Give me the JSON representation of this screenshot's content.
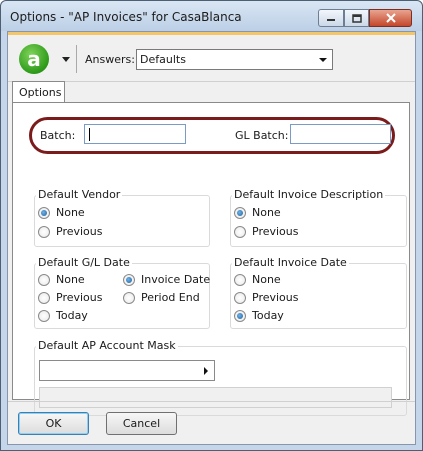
{
  "window": {
    "title": "Options - \"AP Invoices\" for CasaBlanca"
  },
  "title_buttons": {
    "minimize_icon": "minimize-icon",
    "maximize_icon": "maximize-icon",
    "close_icon": "close-icon"
  },
  "toolbar": {
    "logo_letter": "a",
    "answers_label": "Answers:",
    "answers_value": "Defaults"
  },
  "tabs": [
    {
      "label": "Options",
      "selected": true
    }
  ],
  "batch": {
    "batch_label": "Batch:",
    "batch_value": "",
    "gl_batch_label": "GL Batch:",
    "gl_batch_value": ""
  },
  "default_vendor": {
    "title": "Default Vendor",
    "options": [
      {
        "label": "None",
        "selected": true
      },
      {
        "label": "Previous",
        "selected": false
      }
    ]
  },
  "default_invoice_description": {
    "title": "Default Invoice Description",
    "options": [
      {
        "label": "None",
        "selected": true
      },
      {
        "label": "Previous",
        "selected": false
      }
    ]
  },
  "default_gl_date": {
    "title": "Default G/L Date",
    "options": [
      {
        "label": "None",
        "selected": false
      },
      {
        "label": "Invoice Date",
        "selected": true
      },
      {
        "label": "Previous",
        "selected": false
      },
      {
        "label": "Period End",
        "selected": false
      },
      {
        "label": "Today",
        "selected": false
      }
    ]
  },
  "default_invoice_date": {
    "title": "Default Invoice Date",
    "options": [
      {
        "label": "None",
        "selected": false
      },
      {
        "label": "Previous",
        "selected": false
      },
      {
        "label": "Today",
        "selected": true
      }
    ]
  },
  "ap_account_mask": {
    "title": "Default AP Account Mask",
    "value": ""
  },
  "buttons": {
    "ok": "OK",
    "cancel": "Cancel"
  },
  "colors": {
    "highlight_oval": "#7b1c1c",
    "accent_bar": "#f3c66a",
    "logo_green": "#2d9a1a"
  }
}
